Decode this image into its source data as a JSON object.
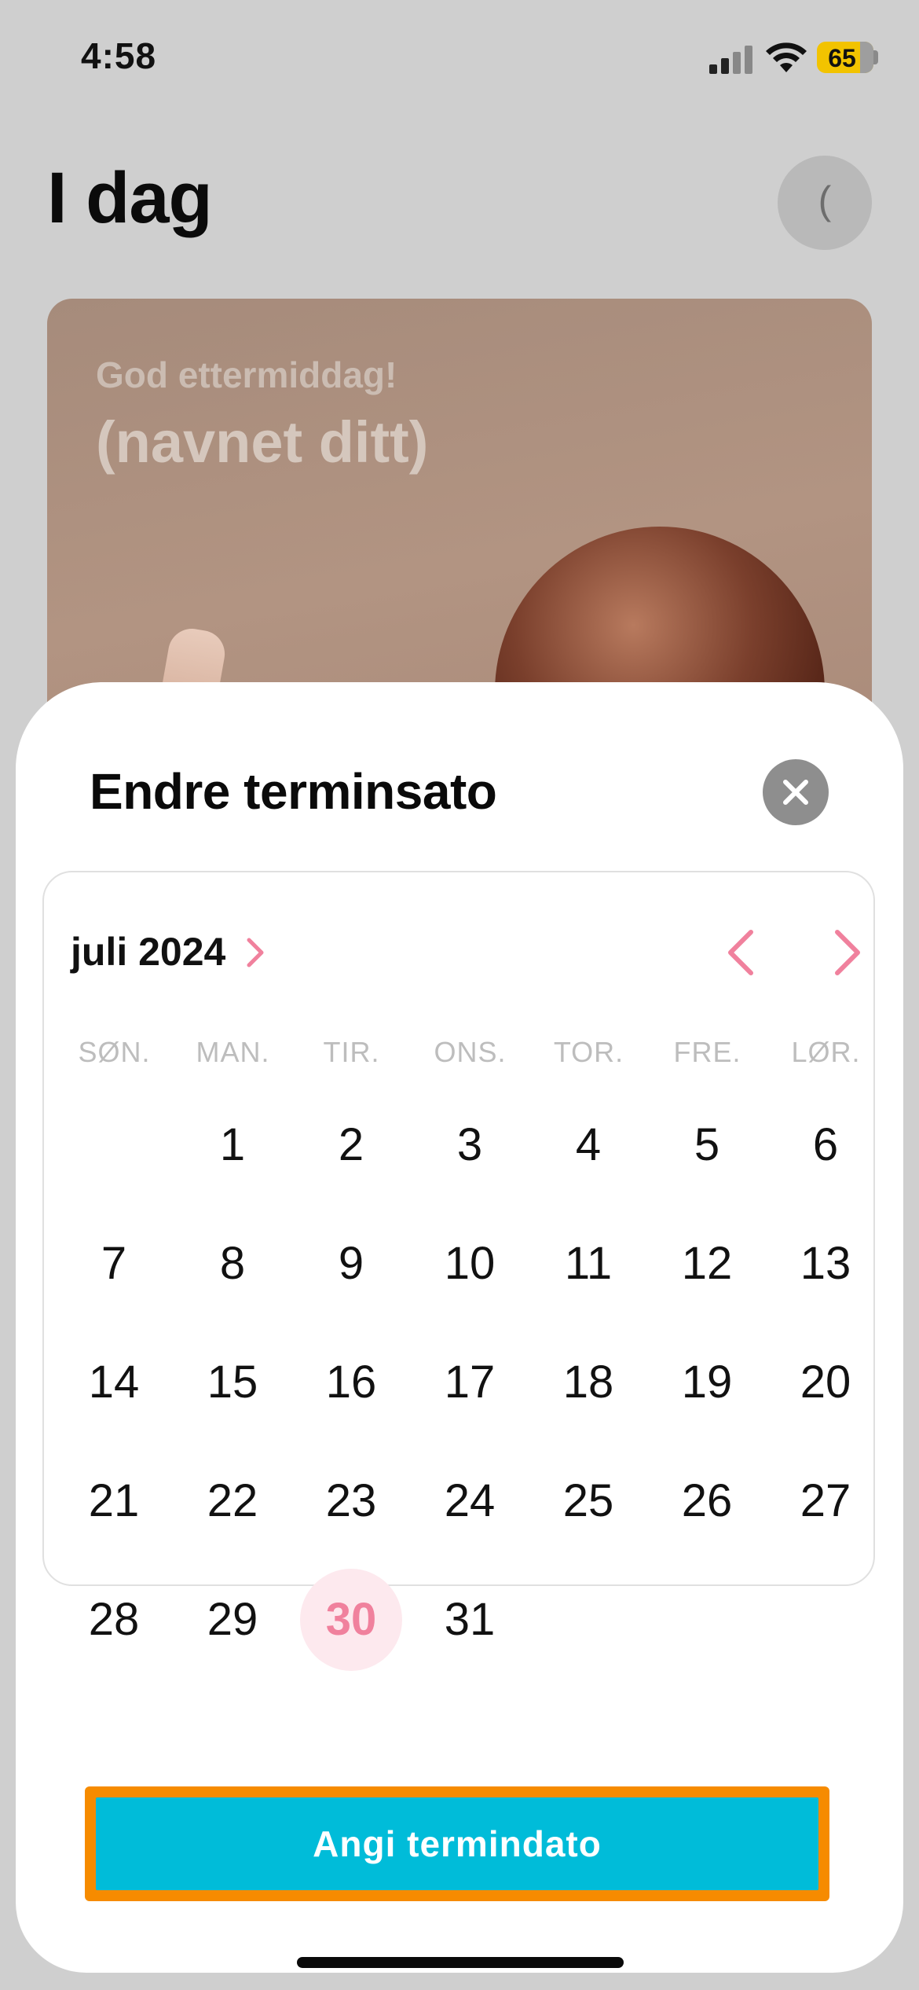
{
  "status_bar": {
    "time": "4:58",
    "battery": "65"
  },
  "header": {
    "title": "I dag",
    "profile_glyph": "("
  },
  "hero": {
    "greeting": "God ettermiddag!",
    "name": "(navnet ditt)"
  },
  "sheet": {
    "title": "Endre terminsato",
    "calendar": {
      "month": "juli 2024",
      "weekdays": [
        "SØN.",
        "MAN.",
        "TIR.",
        "ONS.",
        "TOR.",
        "FRE.",
        "LØR."
      ],
      "weeks": [
        [
          "",
          "1",
          "2",
          "3",
          "4",
          "5",
          "6"
        ],
        [
          "7",
          "8",
          "9",
          "10",
          "11",
          "12",
          "13"
        ],
        [
          "14",
          "15",
          "16",
          "17",
          "18",
          "19",
          "20"
        ],
        [
          "21",
          "22",
          "23",
          "24",
          "25",
          "26",
          "27"
        ],
        [
          "28",
          "29",
          "30",
          "31",
          "",
          "",
          ""
        ]
      ],
      "selected_day": "30"
    },
    "cta_label": "Angi termindato"
  },
  "colors": {
    "accent": "#f0819d",
    "cta": "#00bcd9",
    "cta_outline": "#f68b00"
  }
}
